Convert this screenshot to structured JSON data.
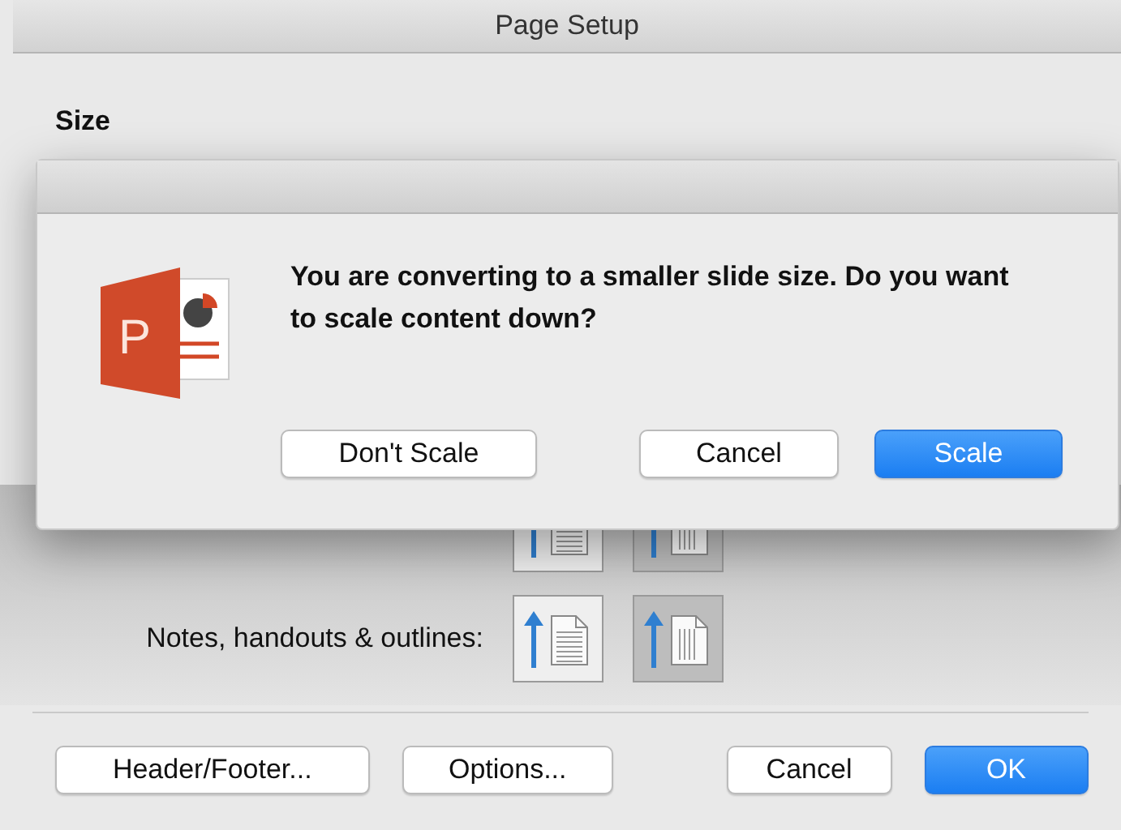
{
  "window": {
    "title": "Page Setup"
  },
  "size_section": {
    "heading": "Size"
  },
  "orientation_rows": [
    {
      "options": [
        {
          "kind": "portrait",
          "selected": false
        },
        {
          "kind": "landscape",
          "selected": true
        }
      ]
    },
    {
      "label": "Notes, handouts & outlines:",
      "options": [
        {
          "kind": "portrait",
          "selected": false
        },
        {
          "kind": "landscape",
          "selected": true
        }
      ]
    }
  ],
  "buttons": [
    {
      "label": "Header/Footer...",
      "kind": "normal"
    },
    {
      "label": "Options...",
      "kind": "normal"
    },
    {
      "label": "Cancel",
      "kind": "normal"
    },
    {
      "label": "OK",
      "kind": "default"
    }
  ],
  "alert": {
    "icon_letter": "P",
    "message": "You are converting to a smaller slide size. Do you want to scale content down?",
    "buttons": [
      {
        "label": "Don't Scale",
        "kind": "normal"
      },
      {
        "label": "Cancel",
        "kind": "normal"
      },
      {
        "label": "Scale",
        "kind": "default"
      }
    ]
  }
}
